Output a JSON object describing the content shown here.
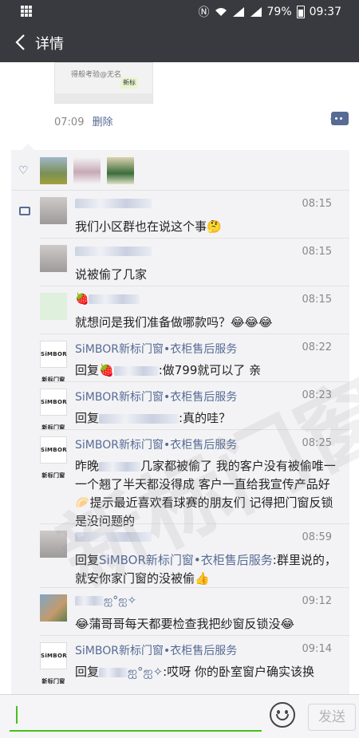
{
  "statusbar": {
    "battery": "79%",
    "time": "09:37"
  },
  "header": {
    "title": "详情"
  },
  "post": {
    "link_text_line1": "得般考验@无名",
    "link_tag": "新标",
    "time": "07:09",
    "delete_label": "删除"
  },
  "comments": [
    {
      "time": "08:15",
      "text": "我们小区群也在说这个事🤔"
    },
    {
      "time": "08:15",
      "text": "说被偷了几家"
    },
    {
      "name_prefix": "🍓",
      "time": "08:15",
      "text": "就想问是我们准备做哪款吗？😂😂😂"
    },
    {
      "name": "SiMBOR新标门窗•衣柜售后服务",
      "time": "08:22",
      "reply_prefix": "回复🍓",
      "text": ":做799就可以了  亲"
    },
    {
      "name": "SiMBOR新标门窗•衣柜售后服务",
      "time": "08:23",
      "reply_prefix": "回复",
      "text": ":真的哇？"
    },
    {
      "name": "SiMBOR新标门窗•衣柜售后服务",
      "time": "08:25",
      "text_a": "昨晚",
      "text_b": "几家都被偷了    我的客户没有被偷唯一一个翘了半天都没得成    客户一直给我宣传产品好🥟提示最近喜欢看球赛的朋友们  记得把门窗反锁  是没问题的"
    },
    {
      "time": "08:59",
      "reply_prefix": "回复",
      "reply_name": "SiMBOR新标门窗•衣柜售后服务",
      "text": ":群里说的，就安你家门窗的没被偷👍"
    },
    {
      "name_suffix": "ஐ°ஐ✧",
      "time": "09:12",
      "text": "😂蒲哥哥每天都要检查我把纱窗反锁没😂"
    },
    {
      "name": "SiMBOR新标门窗•衣柜售后服务",
      "time": "09:14",
      "reply_prefix": "回复",
      "reply_suffix": "ஐ°ஐ✧",
      "text": ":哎呀  你的卧室窗户确实该换"
    }
  ],
  "avatars": {
    "simbor_text": "SiMBOR 新标门窗"
  },
  "input": {
    "placeholder": "",
    "send_label": "发送"
  },
  "colors": {
    "link": "#576b95",
    "send_border": "#45c01a",
    "bar": "#393a3f"
  }
}
